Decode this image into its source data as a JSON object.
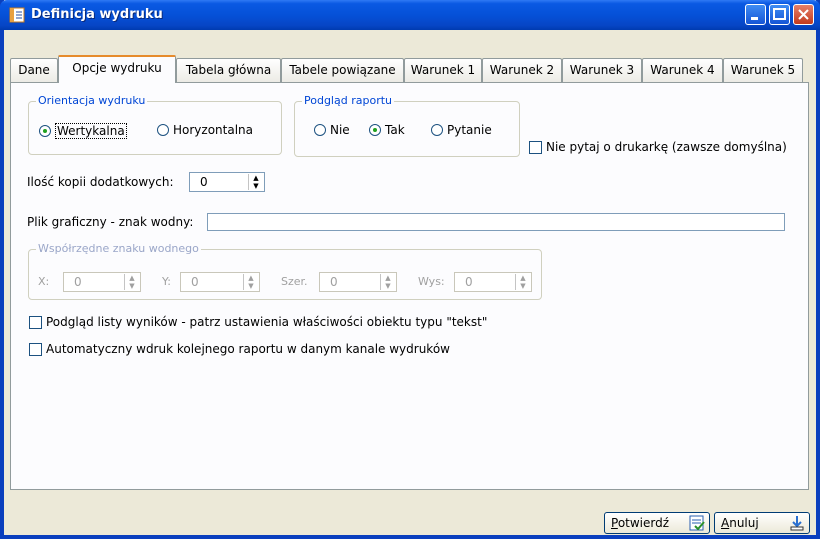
{
  "window": {
    "title": "Definicja wydruku"
  },
  "tabs": [
    "Dane",
    "Opcje wydruku",
    "Tabela główna",
    "Tabele powiązane",
    "Warunek 1",
    "Warunek 2",
    "Warunek 3",
    "Warunek 4",
    "Warunek 5"
  ],
  "orientation": {
    "legend": "Orientacja wydruku",
    "opt1": "Wertykalna",
    "opt2": "Horyzontalna",
    "selected": "Wertykalna"
  },
  "preview": {
    "legend": "Podgląd raportu",
    "opt1": "Nie",
    "opt2": "Tak",
    "opt3": "Pytanie",
    "selected": "Tak"
  },
  "printer_check": {
    "label": "Nie pytaj o drukarkę (zawsze domyślna)",
    "checked": false
  },
  "copies": {
    "label": "Ilość kopii dodatkowych:",
    "value": "0"
  },
  "watermark": {
    "label": "Plik graficzny - znak wodny:",
    "value": ""
  },
  "coords": {
    "legend": "Współrzędne znaku wodnego",
    "x_label": "X:",
    "x": "0",
    "y_label": "Y:",
    "y": "0",
    "w_label": "Szer.",
    "w": "0",
    "h_label": "Wys:",
    "h": "0"
  },
  "check_list_preview": {
    "label": "Podgląd listy wyników - patrz ustawienia właściwości obiektu typu \"tekst\"",
    "checked": false
  },
  "check_auto_print": {
    "label": "Automatyczny wdruk kolejnego raportu w danym kanale wydruków",
    "checked": false
  },
  "buttons": {
    "confirm_acc": "P",
    "confirm_rest": "otwierdź",
    "cancel_acc": "A",
    "cancel_rest": "nuluj"
  }
}
